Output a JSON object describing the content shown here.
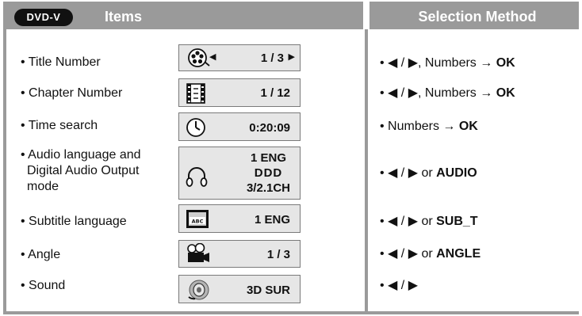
{
  "header": {
    "badge": "DVD-V",
    "items_title": "Items",
    "method_title": "Selection Method"
  },
  "rows": [
    {
      "label": "• Title Number",
      "display": "1 / 3",
      "method": "• ◀ / ▶, Numbers → OK"
    },
    {
      "label": "• Chapter Number",
      "display": "1 / 12",
      "method": "• ◀ / ▶, Numbers → OK"
    },
    {
      "label": "• Time search",
      "display": "0:20:09",
      "method": "• Numbers → OK"
    },
    {
      "label_lines": [
        "• Audio language and",
        "Digital Audio Output",
        "mode"
      ],
      "display_lines": [
        "1 ENG",
        "DDD",
        "3/2.1CH"
      ],
      "method": "• ◀ / ▶ or AUDIO"
    },
    {
      "label": "• Subtitle language",
      "display": "1 ENG",
      "icon_text": "ABC",
      "method": "• ◀ / ▶ or SUB_T"
    },
    {
      "label": "• Angle",
      "display": "1 / 3",
      "method": "• ◀ / ▶ or ANGLE"
    },
    {
      "label": "• Sound",
      "display": "3D SUR",
      "method": "• ◀ / ▶"
    }
  ],
  "methods": {
    "m0": {
      "prefix": "• ◀ / ▶, Numbers → ",
      "key": "OK"
    },
    "m1": {
      "prefix": "• ◀ / ▶, Numbers → ",
      "key": "OK"
    },
    "m2": {
      "prefix": "• Numbers → ",
      "key": "OK"
    },
    "m3": {
      "prefix": "• ◀ / ▶ or ",
      "key": "AUDIO"
    },
    "m4": {
      "prefix": "• ◀ / ▶ or ",
      "key": "SUB_T"
    },
    "m5": {
      "prefix": "• ◀ / ▶ or ",
      "key": "ANGLE"
    },
    "m6": {
      "prefix": "• ◀ / ▶",
      "key": ""
    }
  },
  "title_arrows": {
    "left": "◀",
    "right": "▶"
  },
  "icons": [
    "film-reel-icon",
    "film-strip-icon",
    "clock-icon",
    "headphones-icon",
    "subtitle-abc-icon",
    "movie-camera-icon",
    "speaker-icon"
  ]
}
